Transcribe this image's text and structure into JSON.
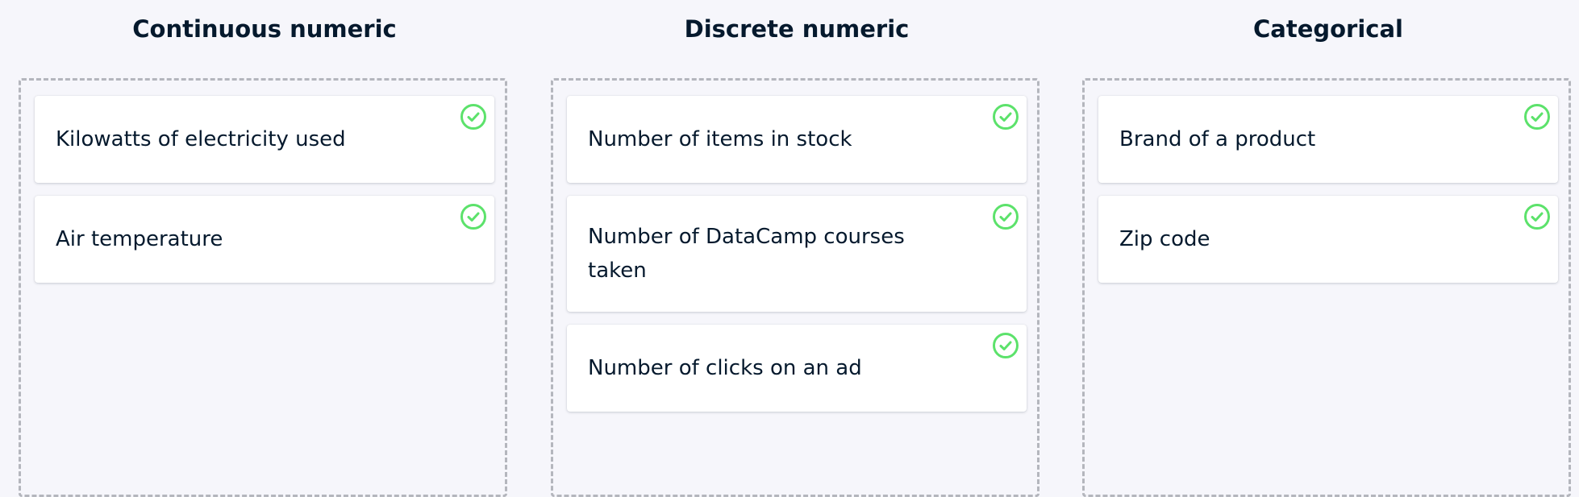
{
  "columns": [
    {
      "title": "Continuous numeric",
      "cards": [
        {
          "label": "Kilowatts of electricity used",
          "icon": "check-circle-icon"
        },
        {
          "label": "Air temperature",
          "icon": "check-circle-icon"
        }
      ]
    },
    {
      "title": "Discrete numeric",
      "cards": [
        {
          "label": "Number of items in stock",
          "icon": "check-circle-icon"
        },
        {
          "label": "Number of DataCamp courses taken",
          "icon": "check-circle-icon"
        },
        {
          "label": "Number of clicks on an ad",
          "icon": "check-circle-icon"
        }
      ]
    },
    {
      "title": "Categorical",
      "cards": [
        {
          "label": "Brand of a product",
          "icon": "check-circle-icon"
        },
        {
          "label": "Zip code",
          "icon": "check-circle-icon"
        }
      ]
    }
  ],
  "colors": {
    "background": "#f6f6fb",
    "text": "#05192d",
    "check": "#5ce26b",
    "dropzone_border": "#b4b6bd",
    "card": "#ffffff"
  }
}
